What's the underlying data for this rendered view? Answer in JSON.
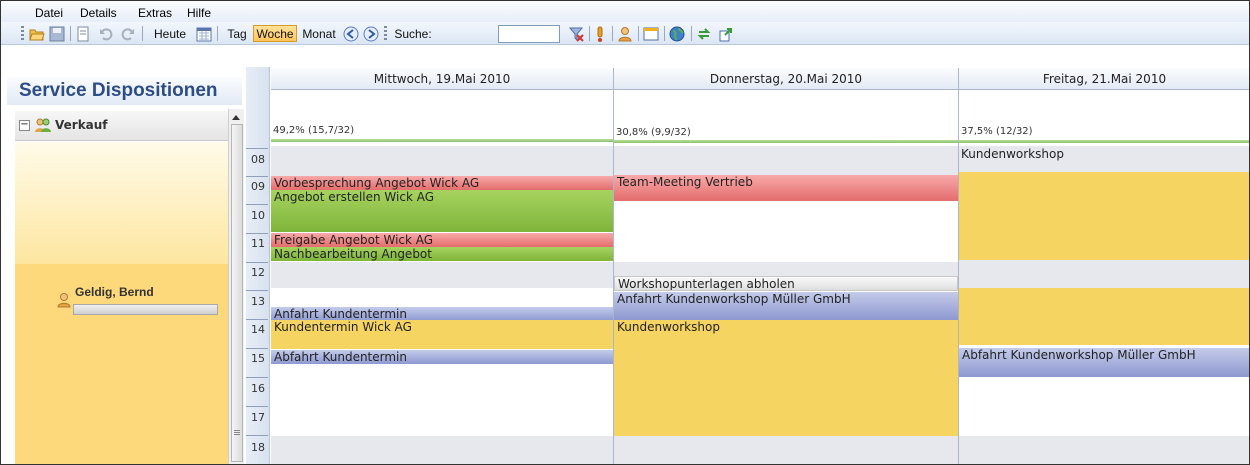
{
  "menu": {
    "datei": "Datei",
    "details": "Details",
    "extras": "Extras",
    "hilfe": "Hilfe"
  },
  "toolbar": {
    "heute": "Heute",
    "tag": "Tag",
    "woche": "Woche",
    "monat": "Monat",
    "suche": "Suche:",
    "search_value": ""
  },
  "left": {
    "title": "Service Dispositionen",
    "group": "Verkauf",
    "group_toggle": "−",
    "resource": "Geldig, Bernd"
  },
  "hours": [
    "08",
    "09",
    "10",
    "11",
    "12",
    "13",
    "14",
    "15",
    "16",
    "17",
    "18"
  ],
  "days": [
    {
      "header": "Mittwoch, 19.Mai 2010",
      "utilization": "49,2% (15,7/32)",
      "events": [
        "Vorbesprechung Angebot Wick AG",
        "Angebot erstellen Wick AG",
        "Freigabe Angebot Wick AG",
        "Nachbearbeitung Angebot",
        "Anfahrt Kundentermin",
        "Kundentermin Wick AG",
        "Abfahrt Kundentermin"
      ]
    },
    {
      "header": "Donnerstag, 20.Mai 2010",
      "utilization": "30,8% (9,9/32)",
      "events": [
        "Team-Meeting Vertrieb",
        "Workshopunterlagen abholen",
        "Anfahrt Kundenworkshop Müller GmbH",
        "Kundenworkshop"
      ]
    },
    {
      "header": "Freitag, 21.Mai 2010",
      "utilization": "37,5% (12/32)",
      "events": [
        "Kundenworkshop",
        "Abfahrt Kundenworkshop Müller GmbH"
      ]
    }
  ],
  "colors": {
    "red": "#e46c6c",
    "green": "#7fb43a",
    "blue": "#8d98cf",
    "yellow": "#f5d462",
    "title_blue": "#2d4d86"
  }
}
